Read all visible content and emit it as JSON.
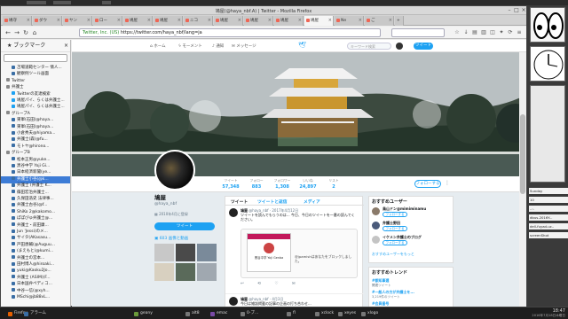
{
  "window": {
    "title": "鳩屋(@haya_nbf.A) | Twitter - Mozilla Firefox"
  },
  "tabs": [
    {
      "label": "鳩守",
      "active": false
    },
    {
      "label": "ダウ",
      "active": false
    },
    {
      "label": "ヤン",
      "active": false
    },
    {
      "label": "ロー",
      "active": false
    },
    {
      "label": "鳩屋",
      "active": false
    },
    {
      "label": "鳩屋",
      "active": false
    },
    {
      "label": "ニコ",
      "active": false
    },
    {
      "label": "鳩屋",
      "active": false
    },
    {
      "label": "鳩屋",
      "active": false
    },
    {
      "label": "鳩屋",
      "active": false
    },
    {
      "label": "鳩屋",
      "active": true
    },
    {
      "label": "Ne",
      "active": false
    },
    {
      "label": "ご",
      "active": false
    }
  ],
  "navbar": {
    "site_label": "Twitter, Inc. (US)",
    "url": "https://twitter.com/haya_nbf/lang=ja"
  },
  "sidebar": {
    "title": "ブックマーク",
    "items": [
      {
        "label": "苫場道範センター 情人...",
        "color": "#3a6ea5"
      },
      {
        "label": "観察例ツール画面",
        "color": "#3a6ea5"
      },
      {
        "label": "Twitter",
        "color": "#888"
      },
      {
        "label": "弁護士",
        "color": "#888"
      },
      {
        "label": "Twitterの友達検索",
        "color": "#1da1f2"
      },
      {
        "label": "鳩屋パイ、らくは弁護士...",
        "color": "#1da1f2"
      },
      {
        "label": "鳩屋パイ、らくは弁護士...",
        "color": "#1da1f2"
      },
      {
        "label": "グループA",
        "color": "#888"
      },
      {
        "label": "東軍(石田)@haya...",
        "color": "#3a6ea5"
      },
      {
        "label": "東軍(石田)@haya...",
        "color": "#3a6ea5"
      },
      {
        "label": "小倉秀夫@hiyama...",
        "color": "#3a6ea5"
      },
      {
        "label": "弁護士(森)@fu...",
        "color": "#3a6ea5"
      },
      {
        "label": "モトヤ@hirono...",
        "color": "#3a6ea5"
      },
      {
        "label": "グループB",
        "color": "#888"
      },
      {
        "label": "松本正男@yuke...",
        "color": "#3a6ea5"
      },
      {
        "label": "黒谷中学 Yoji Gi...",
        "color": "#3a6ea5"
      },
      {
        "label": "日本経済新聞(ye...",
        "color": "#3a6ea5"
      },
      {
        "label": "弁護士小谷(@k...",
        "color": "#3a6ea5",
        "selected": true
      },
      {
        "label": "弁護士 (弁護士 K...",
        "color": "#3a6ea5"
      },
      {
        "label": "篠田宏治弁護士...",
        "color": "#3a6ea5"
      },
      {
        "label": "久保田浩史 法律事...",
        "color": "#3a6ea5"
      },
      {
        "label": "弁護士古谷(@f...",
        "color": "#3a6ea5"
      },
      {
        "label": "ShiKo 2@kakomo...",
        "color": "#3a6ea5"
      },
      {
        "label": "ぽぽびゅ弁護士@...",
        "color": "#3a6ea5"
      },
      {
        "label": "弁護士・前田康...",
        "color": "#3a6ea5"
      },
      {
        "label": "Jun 'Jessi)のメ...",
        "color": "#3a6ea5"
      },
      {
        "label": "サイタ(AKasasu...",
        "color": "#3a6ea5"
      },
      {
        "label": "戸田恵輔(@Auguu...",
        "color": "#3a6ea5"
      },
      {
        "label": "(まえもと)@kumi...",
        "color": "#3a6ea5"
      },
      {
        "label": "弁護士の宮本...",
        "color": "#3a6ea5"
      },
      {
        "label": "田村博人@hiroaki...",
        "color": "#3a6ea5"
      },
      {
        "label": "yuki@Kaoku2Jo...",
        "color": "#3a6ea5"
      },
      {
        "label": "弁護士 (ASIM)(F...",
        "color": "#3a6ea5"
      },
      {
        "label": "日本国弁ペディコ...",
        "color": "#3a6ea5"
      },
      {
        "label": "中谷一信(@xyh...",
        "color": "#3a6ea5"
      },
      {
        "label": "MSchi@jb88vL...",
        "color": "#3a6ea5"
      }
    ]
  },
  "twitter_nav": {
    "home": "ホーム",
    "moments": "モーメント",
    "notifications": "通知",
    "messages": "メッセージ",
    "search_placeholder": "キーワード検索",
    "tweet_button": "ツイート"
  },
  "stats": [
    {
      "label": "ツイート",
      "value": "57,348"
    },
    {
      "label": "フォロー",
      "value": "883"
    },
    {
      "label": "フォロワー",
      "value": "1,308"
    },
    {
      "label": "いいね",
      "value": "24,897"
    },
    {
      "label": "リスト",
      "value": "2"
    }
  ],
  "follow_button": "フォローする",
  "profile": {
    "name": "鳩屋",
    "handle": "@haya_nbf",
    "joined": "2010年4月に登録",
    "tweet_button": "ツイート",
    "media_label": "603 画像と動画"
  },
  "timeline": {
    "tabs": [
      "ツイート",
      "ツイートと返信",
      "メディア"
    ],
    "tweets": [
      {
        "name": "鳩屋",
        "meta": "@haya_nbf · 2017年4月12日",
        "text": "ツイートを読んでもらうのは...  今日、今日のツイートを一番の読んでください。"
      },
      {
        "name": "鳩屋",
        "meta": "@haya_nbf · 4月3日",
        "text": "今日は雑誌掲載の記事の企画の打ち合わせ..."
      }
    ],
    "card_name": "黒谷中学 Yoji Genba",
    "card_text": "@jpamishはあなたをブロックしました。"
  },
  "suggestions": {
    "title": "おすすめユーザー",
    "items": [
      {
        "name": "鳥山ドン@mimiminamu",
        "button": "フォローする"
      },
      {
        "name": "弁護士野田",
        "button": "フォローする"
      },
      {
        "name": "イケメン弁護士のブログ",
        "button": "フォローする"
      }
    ],
    "more": "おすすめユーザーをもっと"
  },
  "trends": {
    "title": "おすすめトレンド",
    "items": [
      {
        "tag": "#都知事選",
        "sub": "関連ツイート"
      },
      {
        "tag": "#一般人の方が弁護士を...",
        "sub": "3,219件のツイート"
      },
      {
        "tag": "#会員番号",
        "sub": ""
      }
    ]
  },
  "taskbar": {
    "items": [
      {
        "label": "Firefox",
        "color": "#e66000"
      },
      {
        "label": "アラーム",
        "color": "#3a6ea5"
      },
      {
        "label": "geany",
        "color": "#6a9a3a"
      },
      {
        "label": "alt8",
        "color": "#777"
      },
      {
        "label": "emac",
        "color": "#7a4aa5"
      },
      {
        "label": "0-ブ...",
        "color": "#777"
      },
      {
        "label": "fl",
        "color": "#777"
      },
      {
        "label": "xclock",
        "color": "#777"
      },
      {
        "label": "xeyes",
        "color": "#777"
      },
      {
        "label": "xlogo",
        "color": "#777"
      }
    ],
    "clock_time": "18:47",
    "clock_date": "2016年7月18日木曜日"
  },
  "desktop_right": {
    "items": [
      "Sunday",
      "10 ",
      "..:.",
      "dbus-2016Y...",
      "dell-fuyad-uc..",
      "screenShot"
    ]
  }
}
